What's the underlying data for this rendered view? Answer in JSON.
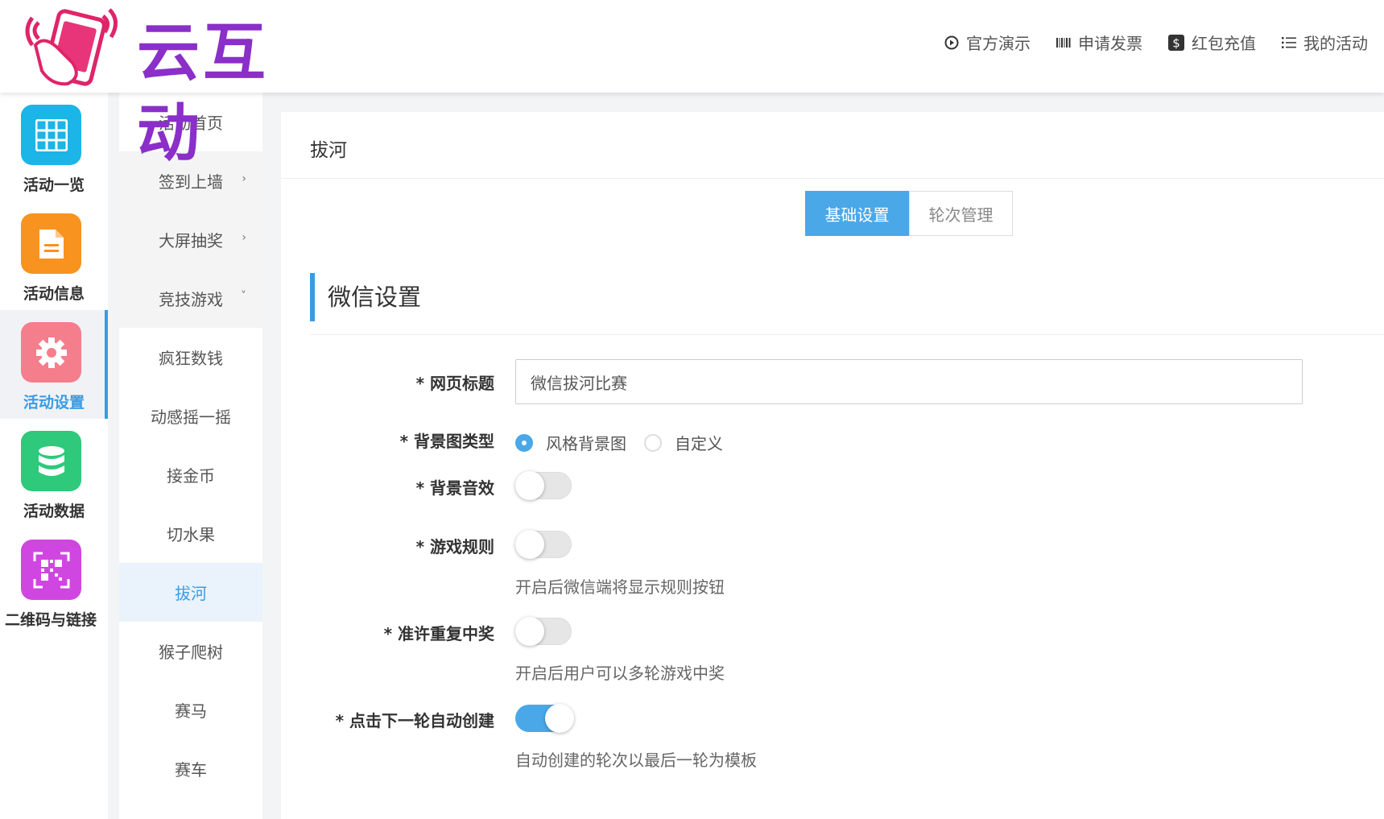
{
  "brand": {
    "name": "云互动"
  },
  "topnav": [
    {
      "label": "官方演示",
      "icon": "play-circle-icon"
    },
    {
      "label": "申请发票",
      "icon": "barcode-icon"
    },
    {
      "label": "红包充值",
      "icon": "dollar-icon"
    },
    {
      "label": "我的活动",
      "icon": "list-icon"
    }
  ],
  "icon_sidebar": [
    {
      "label": "活动一览",
      "icon": "grid-icon",
      "color": "#1cb5e8"
    },
    {
      "label": "活动信息",
      "icon": "document-icon",
      "color": "#f7931e"
    },
    {
      "label": "活动设置",
      "icon": "gear-icon",
      "color": "#f57e8c",
      "active": true
    },
    {
      "label": "活动数据",
      "icon": "database-icon",
      "color": "#2ec97a"
    },
    {
      "label": "二维码与链接",
      "icon": "qrcode-icon",
      "color": "#d046e0"
    }
  ],
  "sub_sidebar": [
    {
      "label": "活动首页"
    },
    {
      "label": "签到上墙",
      "chevron": "›"
    },
    {
      "label": "大屏抽奖",
      "chevron": "›"
    },
    {
      "label": "竞技游戏",
      "chevron": "˅"
    },
    {
      "label": "疯狂数钱"
    },
    {
      "label": "动感摇一摇"
    },
    {
      "label": "接金币"
    },
    {
      "label": "切水果"
    },
    {
      "label": "拔河",
      "active": true
    },
    {
      "label": "猴子爬树"
    },
    {
      "label": "赛马"
    },
    {
      "label": "赛车"
    }
  ],
  "page": {
    "title": "拔河",
    "tabs": [
      {
        "label": "基础设置",
        "active": true
      },
      {
        "label": "轮次管理"
      }
    ],
    "section_title": "微信设置",
    "form": {
      "page_title_label": "* 网页标题",
      "page_title_value": "微信拔河比赛",
      "bg_type_label": "* 背景图类型",
      "bg_type_options": [
        "风格背景图",
        "自定义"
      ],
      "bg_type_selected": "风格背景图",
      "bg_sound_label": "* 背景音效",
      "bg_sound_on": false,
      "rules_label": "* 游戏规则",
      "rules_on": false,
      "rules_hint": "开启后微信端将显示规则按钮",
      "repeat_win_label": "* 准许重复中奖",
      "repeat_win_on": false,
      "repeat_win_hint": "开启后用户可以多轮游戏中奖",
      "auto_create_label": "* 点击下一轮自动创建",
      "auto_create_on": true,
      "auto_create_hint": "自动创建的轮次以最后一轮为模板"
    }
  }
}
